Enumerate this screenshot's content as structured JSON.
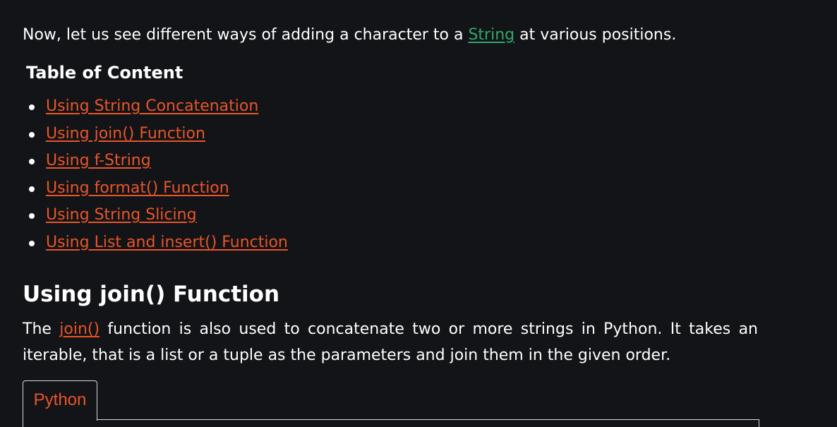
{
  "intro": {
    "before": "Now, let us see different ways of adding a character to a ",
    "link": "String",
    "after": " at various positions."
  },
  "toc": {
    "title": "Table of Content",
    "items": [
      "Using String Concatenation",
      "Using join() Function",
      "Using f-String",
      "Using format() Function",
      "Using String Slicing",
      "Using List and insert() Function"
    ]
  },
  "section": {
    "title": "Using join() Function",
    "paragraph": {
      "before": "The ",
      "link": "join()",
      "after": " function is also used to concatenate two or more strings in Python. It takes an iterable, that is a list or a tuple as the parameters and join them in the given order."
    }
  },
  "code": {
    "tab_label": "Python"
  },
  "colors": {
    "background": "#131417",
    "link_orange": "#e8552a",
    "link_green": "#2fa86b",
    "text": "#ffffff"
  }
}
